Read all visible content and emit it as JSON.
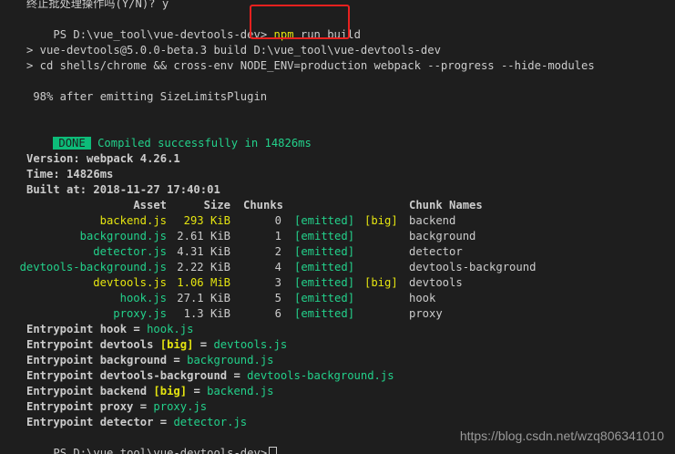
{
  "lines": {
    "top": "终止批处理操作吗(Y/N)? y",
    "prompt1": "PS D:\\vue_tool\\vue-devtools-dev>",
    "cmd_npm": "npm",
    "cmd_rest": " run build",
    "script1": "> vue-devtools@5.0.0-beta.3 build D:\\vue_tool\\vue-devtools-dev",
    "script2": "> cd shells/chrome && cross-env NODE_ENV=production webpack --progress --hide-modules",
    "progress": " 98% after emitting SizeLimitsPlugin",
    "done_badge": "DONE",
    "done_text": "Compiled successfully in 14826ms",
    "version": "Version: webpack 4.26.1",
    "time": "Time: 14826ms",
    "built_at": "Built at: 2018-11-27 17:40:01",
    "prompt2": "PS D:\\vue_tool\\vue-devtools-dev>"
  },
  "table": {
    "headers": {
      "asset": "Asset",
      "size": "Size",
      "chunks": "Chunks",
      "chunk_names": "Chunk Names"
    },
    "rows": [
      {
        "asset": "backend.js",
        "size": "293 KiB",
        "chunk": "0",
        "emitted": "[emitted]",
        "big": "[big]",
        "name": "backend",
        "asset_color": "#e5e510",
        "size_color": "#e5e510"
      },
      {
        "asset": "background.js",
        "size": "2.61 KiB",
        "chunk": "1",
        "emitted": "[emitted]",
        "big": "",
        "name": "background",
        "asset_color": "#23d18b",
        "size_color": "#cccccc"
      },
      {
        "asset": "detector.js",
        "size": "4.31 KiB",
        "chunk": "2",
        "emitted": "[emitted]",
        "big": "",
        "name": "detector",
        "asset_color": "#23d18b",
        "size_color": "#cccccc"
      },
      {
        "asset": "devtools-background.js",
        "size": "2.22 KiB",
        "chunk": "4",
        "emitted": "[emitted]",
        "big": "",
        "name": "devtools-background",
        "asset_color": "#23d18b",
        "size_color": "#cccccc"
      },
      {
        "asset": "devtools.js",
        "size": "1.06 MiB",
        "chunk": "3",
        "emitted": "[emitted]",
        "big": "[big]",
        "name": "devtools",
        "asset_color": "#e5e510",
        "size_color": "#e5e510"
      },
      {
        "asset": "hook.js",
        "size": "27.1 KiB",
        "chunk": "5",
        "emitted": "[emitted]",
        "big": "",
        "name": "hook",
        "asset_color": "#23d18b",
        "size_color": "#cccccc"
      },
      {
        "asset": "proxy.js",
        "size": "1.3 KiB",
        "chunk": "6",
        "emitted": "[emitted]",
        "big": "",
        "name": "proxy",
        "asset_color": "#23d18b",
        "size_color": "#cccccc"
      }
    ]
  },
  "entrypoints": [
    {
      "prefix": "Entrypoint hook",
      "big": "",
      "file": "hook.js"
    },
    {
      "prefix": "Entrypoint devtools",
      "big": "[big]",
      "file": "devtools.js"
    },
    {
      "prefix": "Entrypoint background",
      "big": "",
      "file": "background.js"
    },
    {
      "prefix": "Entrypoint devtools-background",
      "big": "",
      "file": "devtools-background.js"
    },
    {
      "prefix": "Entrypoint backend",
      "big": "[big]",
      "file": "backend.js"
    },
    {
      "prefix": "Entrypoint proxy",
      "big": "",
      "file": "proxy.js"
    },
    {
      "prefix": "Entrypoint detector",
      "big": "",
      "file": "detector.js"
    }
  ],
  "watermark": "https://blog.csdn.net/wzq806341010",
  "colors": {
    "background": "#1e1e1e",
    "text": "#cccccc",
    "yellow": "#e5e510",
    "green": "#23d18b",
    "done_bg": "#0dbc79",
    "highlight_border": "#e8211f"
  }
}
